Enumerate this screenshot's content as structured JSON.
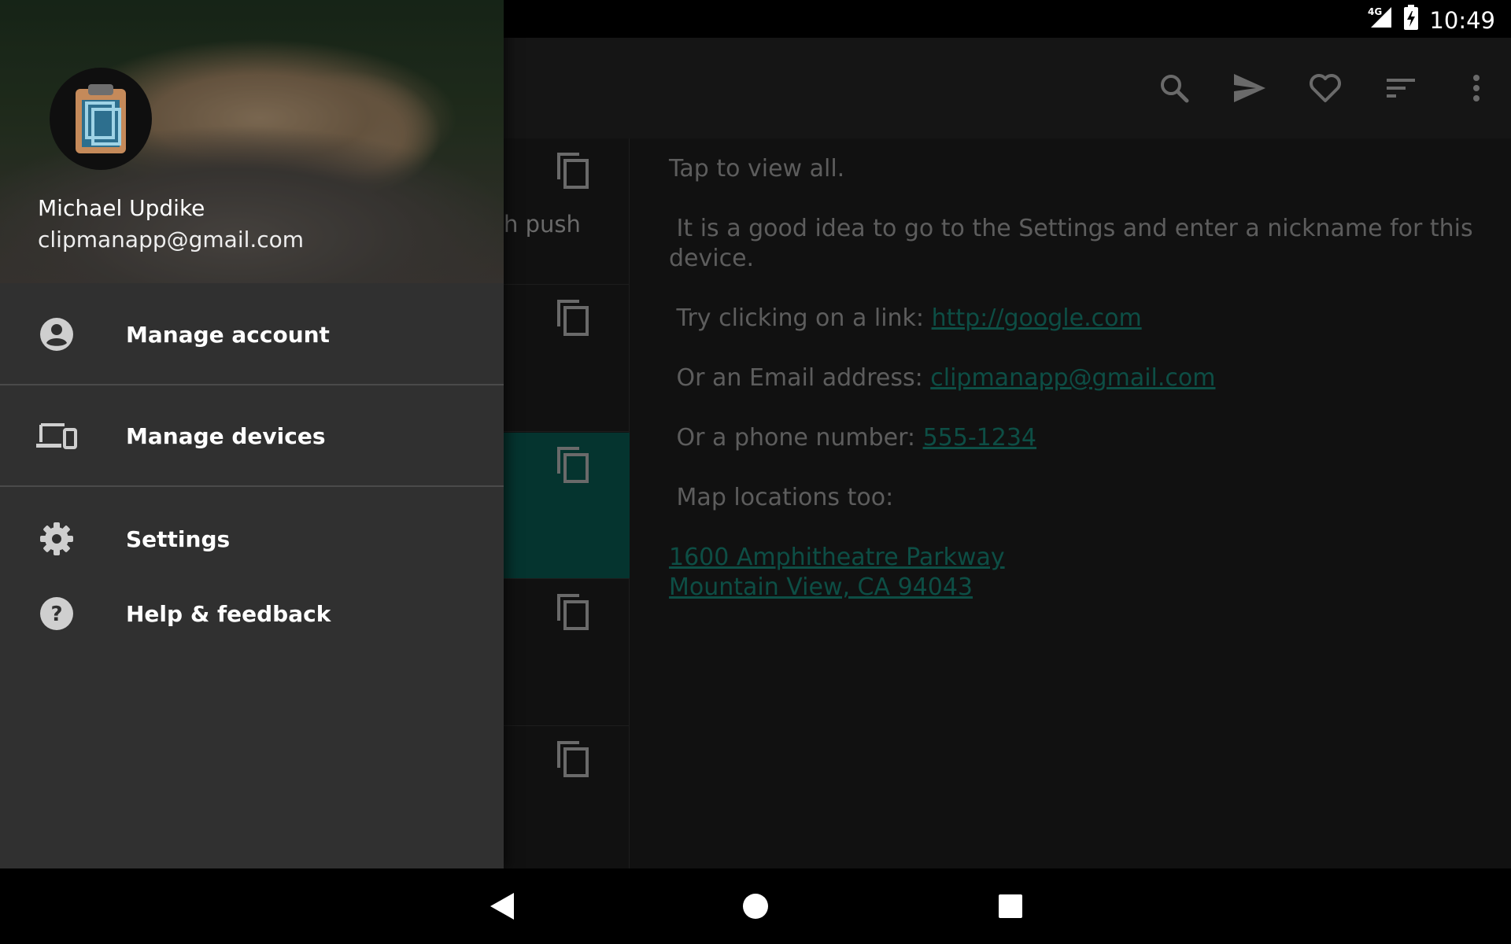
{
  "status_bar": {
    "left_icons": [
      "sd-card-icon",
      "a-badge-icon"
    ],
    "network": "4G",
    "time": "10:49"
  },
  "app_bar": {
    "actions": [
      "search-icon",
      "send-icon",
      "heart-icon",
      "sort-icon",
      "more-vert-icon"
    ]
  },
  "list": {
    "peek_text": "h push",
    "rows": 5,
    "selected_index": 2
  },
  "detail": {
    "line1": "Tap to view all.",
    "line2": " It is a good idea to go to the Settings and enter a nickname for this device.",
    "link_prefix": " Try clicking on a link: ",
    "link": "http://google.com",
    "email_prefix": " Or an Email address: ",
    "email": "clipmanapp@gmail.com",
    "phone_prefix": " Or a phone number: ",
    "phone": "555-1234",
    "map_label": " Map locations too:",
    "address_line1": "1600 Amphitheatre Parkway",
    "address_line2": "Mountain View, CA 94043"
  },
  "drawer": {
    "user_name": "Michael Updike",
    "user_email": "clipmanapp@gmail.com",
    "items": [
      {
        "label": "Manage account",
        "icon": "account-circle-icon"
      },
      {
        "label": "Manage devices",
        "icon": "devices-icon"
      },
      {
        "label": "Settings",
        "icon": "gear-icon"
      },
      {
        "label": "Help & feedback",
        "icon": "help-icon"
      }
    ]
  },
  "colors": {
    "accent": "#0d4e45",
    "drawer_bg": "#303030",
    "selected_row": "#05342f"
  }
}
